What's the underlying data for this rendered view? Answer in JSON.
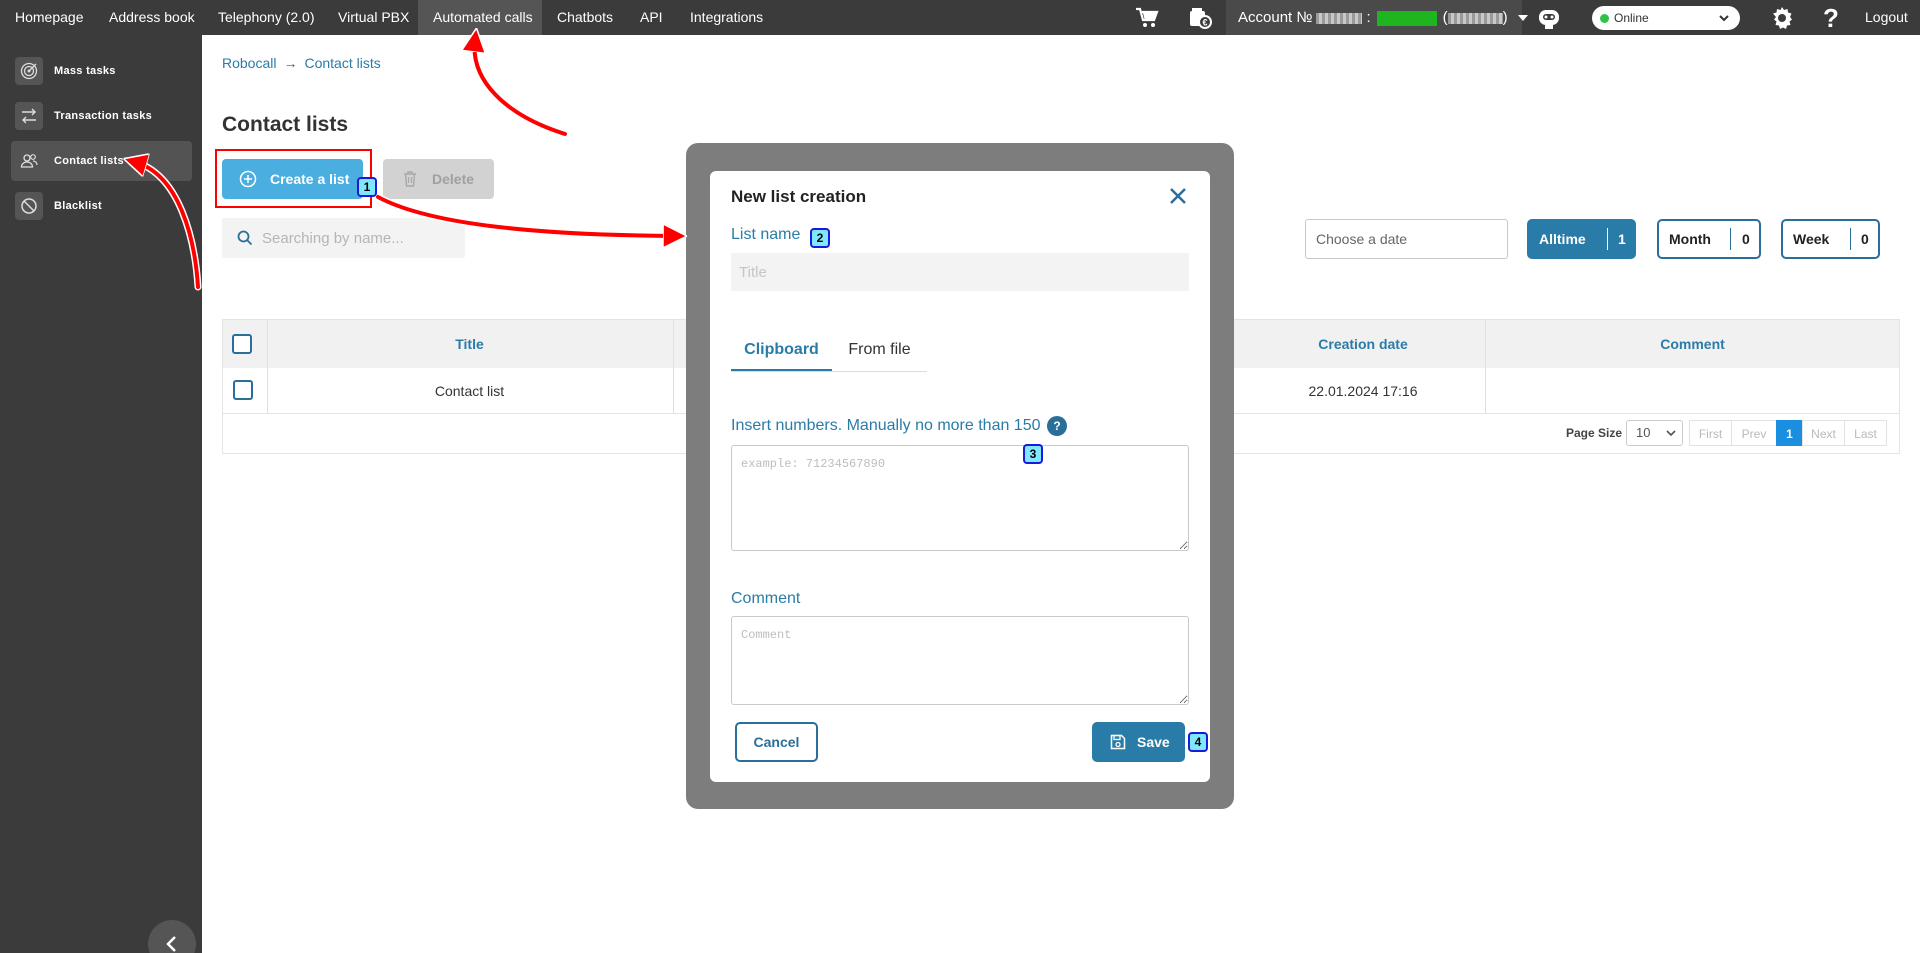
{
  "topnav": {
    "items": [
      "Homepage",
      "Address book",
      "Telephony (2.0)",
      "Virtual PBX",
      "Automated calls",
      "Chatbots",
      "API",
      "Integrations"
    ],
    "active": "Automated calls",
    "account_label": "Account №",
    "account_sep": ":",
    "account_paren_open": "(",
    "account_paren_close": ")",
    "status": "Online",
    "logout": "Logout",
    "icons": [
      "cart-icon",
      "wallet-icon",
      "robot-icon",
      "gear-icon",
      "help-icon"
    ]
  },
  "sidebar": {
    "items": [
      "Mass tasks",
      "Transaction tasks",
      "Contact lists",
      "Blacklist"
    ],
    "active": "Contact lists"
  },
  "breadcrumb": {
    "root": "Robocall",
    "sep": "→",
    "current": "Contact lists"
  },
  "page": {
    "title": "Contact lists",
    "create_button": "Create a list",
    "delete_button": "Delete",
    "search_placeholder": "Searching by name...",
    "date_placeholder": "Choose a date"
  },
  "filters": [
    {
      "label": "Alltime",
      "count": "1",
      "active": true
    },
    {
      "label": "Month",
      "count": "0",
      "active": false
    },
    {
      "label": "Week",
      "count": "0",
      "active": false
    }
  ],
  "table": {
    "columns": [
      "Title",
      "Creation date",
      "Comment"
    ],
    "rows": [
      {
        "title": "Contact list",
        "creation_date": "22.01.2024 17:16",
        "comment": ""
      }
    ]
  },
  "pagination": {
    "page_size_label": "Page Size",
    "page_size": "10",
    "first": "First",
    "prev": "Prev",
    "current": "1",
    "next": "Next",
    "last": "Last"
  },
  "modal": {
    "title": "New list creation",
    "list_name_label": "List name",
    "list_name_placeholder": "Title",
    "tabs": [
      "Clipboard",
      "From file"
    ],
    "active_tab": "Clipboard",
    "numbers_label": "Insert numbers. Manually no more than 150",
    "help_glyph": "?",
    "numbers_placeholder": "example: 71234567890",
    "comment_label": "Comment",
    "comment_placeholder": "Comment",
    "cancel_button": "Cancel",
    "save_button": "Save"
  },
  "annotations": {
    "markers": [
      "1",
      "2",
      "3",
      "4"
    ]
  },
  "colors": {
    "accent": "#2a7ca8",
    "create_button": "#4aaee0",
    "nav_bg": "#3b3b3b",
    "annotation_red": "#ff0000",
    "marker_fill": "#7fe7ff",
    "online_dot": "#2ec24a"
  }
}
